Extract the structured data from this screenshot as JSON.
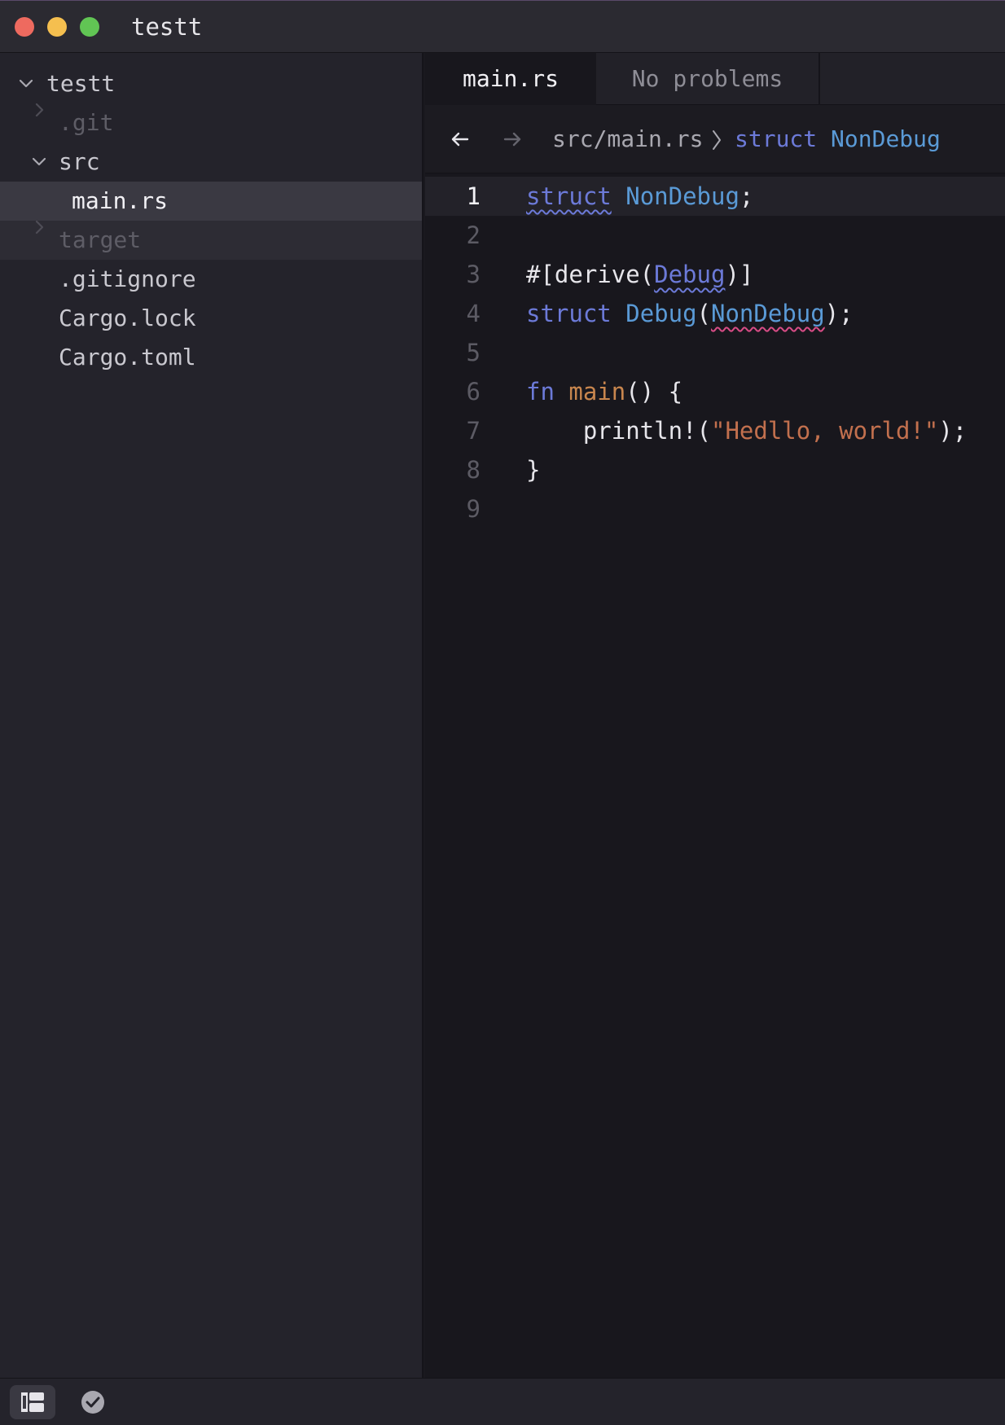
{
  "window": {
    "title": "testt",
    "controls": [
      "close",
      "minimize",
      "maximize"
    ]
  },
  "sidebar": {
    "root": {
      "label": "testt",
      "expanded": true
    },
    "items": [
      {
        "label": ".git",
        "kind": "folder",
        "expanded": false,
        "ignored": true
      },
      {
        "label": "src",
        "kind": "folder",
        "expanded": true
      },
      {
        "label": "main.rs",
        "kind": "file",
        "selected": true
      },
      {
        "label": "target",
        "kind": "folder",
        "expanded": false,
        "ignored": true
      },
      {
        "label": ".gitignore",
        "kind": "file"
      },
      {
        "label": "Cargo.lock",
        "kind": "file"
      },
      {
        "label": "Cargo.toml",
        "kind": "file"
      }
    ]
  },
  "tabs": [
    {
      "label": "main.rs",
      "active": true
    },
    {
      "label": "No problems",
      "active": false
    }
  ],
  "breadcrumbs": {
    "back_icon": "arrow-left-icon",
    "forward_icon": "arrow-right-icon",
    "path": "src/main.rs",
    "symbol_keyword": "struct",
    "symbol_name": "NonDebug"
  },
  "editor": {
    "current_line": 1,
    "line_numbers": [
      "1",
      "2",
      "3",
      "4",
      "5",
      "6",
      "7",
      "8",
      "9"
    ],
    "lines": [
      [
        {
          "t": "struct",
          "c": "kw",
          "sq": "warn"
        },
        {
          "t": " ",
          "c": "pl"
        },
        {
          "t": "NonDebug",
          "c": "ty"
        },
        {
          "t": ";",
          "c": "pl"
        }
      ],
      [],
      [
        {
          "t": "#[derive(",
          "c": "pl"
        },
        {
          "t": "Debug",
          "c": "kw",
          "sq": "warn"
        },
        {
          "t": ")]",
          "c": "pl"
        }
      ],
      [
        {
          "t": "struct",
          "c": "kw"
        },
        {
          "t": " ",
          "c": "pl"
        },
        {
          "t": "Debug",
          "c": "ty"
        },
        {
          "t": "(",
          "c": "pl"
        },
        {
          "t": "NonDebug",
          "c": "ty",
          "sq": "err"
        },
        {
          "t": ");",
          "c": "pl"
        }
      ],
      [],
      [
        {
          "t": "fn",
          "c": "kw"
        },
        {
          "t": " ",
          "c": "pl"
        },
        {
          "t": "main",
          "c": "fn"
        },
        {
          "t": "() {",
          "c": "pl"
        }
      ],
      [
        {
          "t": "    println!(",
          "c": "pl"
        },
        {
          "t": "\"Hedllo, world!\"",
          "c": "str"
        },
        {
          "t": ");",
          "c": "pl"
        }
      ],
      [
        {
          "t": "}",
          "c": "pl"
        }
      ],
      []
    ]
  },
  "statusbar": {
    "items": [
      {
        "icon": "project-panel-icon",
        "active": true
      },
      {
        "icon": "diagnostics-check-icon",
        "active": false
      }
    ]
  },
  "colors": {
    "keyword": "#6c7ad8",
    "type": "#5a9ad6",
    "function": "#c8864e",
    "string": "#c2704e",
    "warning_squiggle": "#6c7ad8",
    "error_squiggle": "#d84c86"
  }
}
